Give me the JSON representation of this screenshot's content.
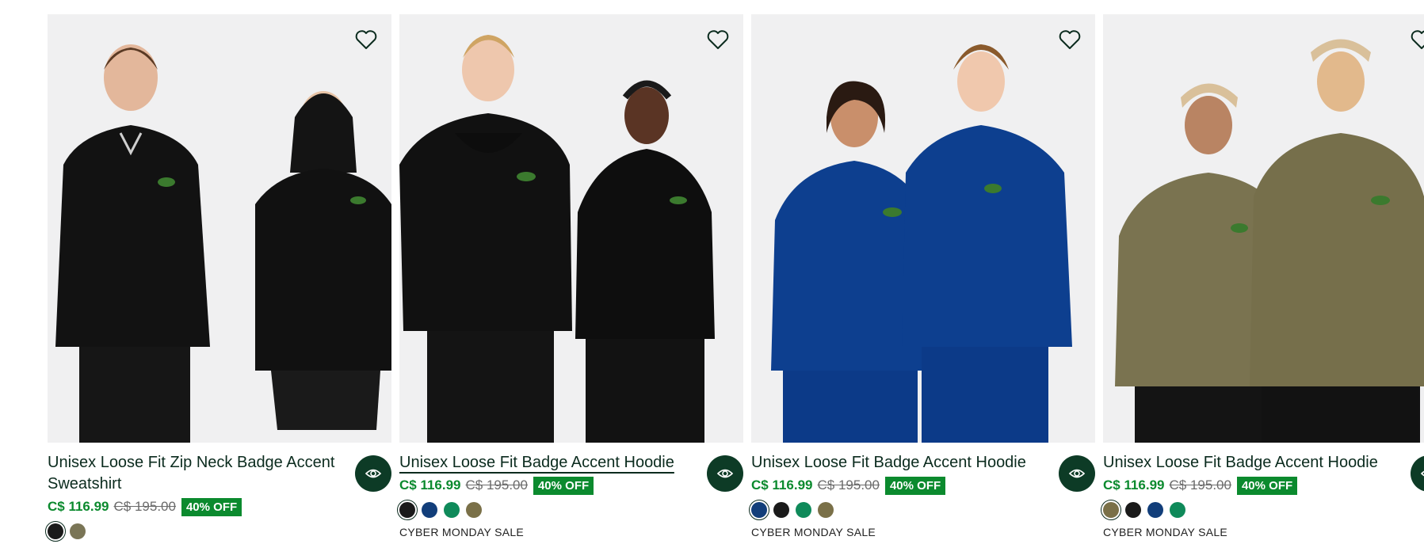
{
  "products": [
    {
      "title": "Unisex Loose Fit Zip Neck Badge Accent Sweatshirt",
      "price": "C$ 116.99",
      "old_price": "C$ 195.00",
      "discount": "40% OFF",
      "colors": [
        "#1a1a1a",
        "#7a7556"
      ],
      "selected_color": 0,
      "promo": ""
    },
    {
      "title": "Unisex Loose Fit Badge Accent Hoodie",
      "price": "C$ 116.99",
      "old_price": "C$ 195.00",
      "discount": "40% OFF",
      "colors": [
        "#1a1a1a",
        "#123e7a",
        "#0f8a5a",
        "#7a7048"
      ],
      "selected_color": 0,
      "promo": "CYBER MONDAY SALE"
    },
    {
      "title": "Unisex Loose Fit Badge Accent Hoodie",
      "price": "C$ 116.99",
      "old_price": "C$ 195.00",
      "discount": "40% OFF",
      "colors": [
        "#123e7a",
        "#1a1a1a",
        "#0f8a5a",
        "#7a7048"
      ],
      "selected_color": 0,
      "promo": "CYBER MONDAY SALE"
    },
    {
      "title": "Unisex Loose Fit Badge Accent Hoodie",
      "price": "C$ 116.99",
      "old_price": "C$ 195.00",
      "discount": "40% OFF",
      "colors": [
        "#7a7048",
        "#1a1a1a",
        "#123e7a",
        "#0f8a5a"
      ],
      "selected_color": 0,
      "promo": "CYBER MONDAY SALE"
    }
  ],
  "icons": {
    "wishlist": "heart-outline-icon",
    "quick_view": "eye-icon"
  },
  "theme": {
    "sale_green": "#0b8a2e",
    "brand_dark": "#0d3b26"
  }
}
